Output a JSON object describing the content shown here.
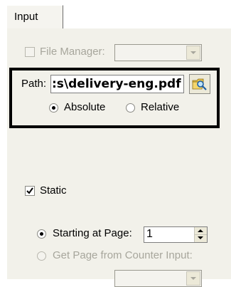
{
  "tabs": [
    {
      "label": "Input"
    }
  ],
  "file_manager": {
    "label": "File Manager:",
    "checked": false,
    "enabled": false,
    "value": ""
  },
  "path": {
    "label": "Path:",
    "value": ":s\\delivery-eng.pdf"
  },
  "path_mode": {
    "options": [
      "Absolute",
      "Relative"
    ],
    "selected": "Absolute"
  },
  "static": {
    "label": "Static",
    "checked": true
  },
  "page_source": {
    "starting_label": "Starting at Page:",
    "starting_value": "1",
    "counter_label": "Get Page from Counter Input:",
    "selected": "Starting at Page:"
  },
  "counter_input": {
    "value": ""
  },
  "icons": {
    "browse": "folder-search-icon"
  },
  "colors": {
    "panel": "#f2f1ea",
    "highlight_border": "#000000",
    "disabled_text": "#a7a69c"
  }
}
